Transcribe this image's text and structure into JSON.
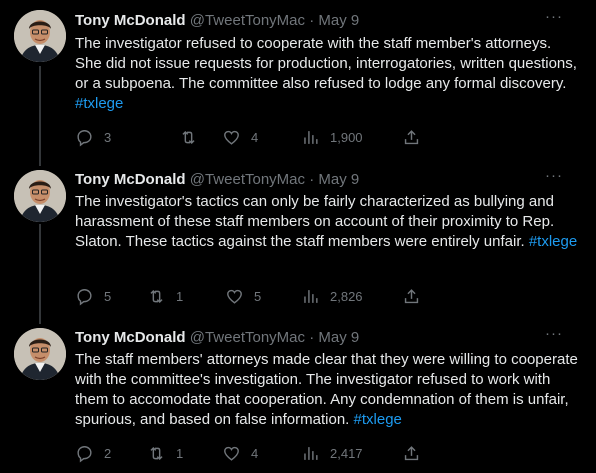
{
  "tweets": [
    {
      "name": "Tony McDonald",
      "handle": "@TweetTonyMac",
      "dot": "·",
      "date": "May 9",
      "more": "···",
      "text": "The investigator refused to cooperate with the staff member's attorneys. She did not issue requests for production, interrogatories, written questions, or a subpoena. The committee also refused to lodge any formal discovery. ",
      "hashtag": "#txlege",
      "replies": "3",
      "retweets": "",
      "likes": "4",
      "views": "1,900"
    },
    {
      "name": "Tony McDonald",
      "handle": "@TweetTonyMac",
      "dot": "·",
      "date": "May 9",
      "more": "···",
      "text": "The investigator's tactics can only be fairly characterized as bullying and harassment of these staff members on account of their proximity to Rep. Slaton. These tactics against the staff members were entirely unfair. ",
      "hashtag": "#txlege",
      "replies": "5",
      "retweets": "1",
      "likes": "5",
      "views": "2,826"
    },
    {
      "name": "Tony McDonald",
      "handle": "@TweetTonyMac",
      "dot": "·",
      "date": "May 9",
      "more": "···",
      "text": "The staff members' attorneys made clear that they were willing to cooperate with the committee's investigation. The investigator refused to work with them to accomodate that cooperation. Any condemnation of them is unfair, spurious, and based on false information. ",
      "hashtag": "#txlege",
      "replies": "2",
      "retweets": "1",
      "likes": "4",
      "views": "2,417"
    }
  ],
  "icons": {
    "reply": "reply-icon",
    "retweet": "retweet-icon",
    "like": "heart-icon",
    "views": "views-icon",
    "share": "share-icon"
  },
  "colors": {
    "background": "#000000",
    "text": "#e7e9ea",
    "muted": "#71767b",
    "link": "#1d9bf0"
  }
}
